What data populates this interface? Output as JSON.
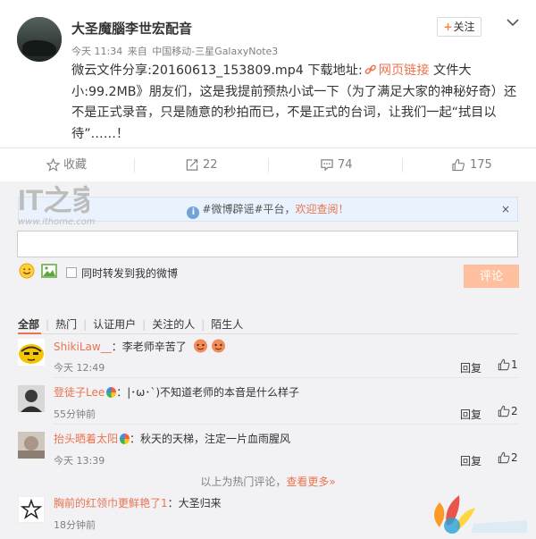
{
  "post": {
    "username": "大圣魔腦李世宏配音",
    "follow_label": "关注",
    "follow_plus": "+",
    "meta_time": "今天 11:34",
    "meta_from": "来自",
    "meta_source": "中国移动-三星GalaxyNote3",
    "content_before_link": "微云文件分享:20160613_153809.mp4 下载地址:",
    "link_label": "网页链接",
    "content_after_link": " 文件大小:99.2MB》朋友们，这是我提前预热小试一下（为了满足大家的神秘好奇）还不是正式录音，只是随意的秒拍而已，不是正式的台词，让我们一起“拭目以待”……！"
  },
  "actions": {
    "favorite_label": "收藏",
    "repost_count": "22",
    "comment_count": "74",
    "like_count": "175"
  },
  "notice": {
    "info_glyph": "i",
    "tag_text": "#微博辟谣#平台，",
    "highlight": "欢迎查阅！",
    "close": "×"
  },
  "composer": {
    "input_value": "",
    "also_repost_label": "同时转发到我的微博",
    "submit_label": "评论"
  },
  "filters": {
    "active": "全部",
    "divider": "|",
    "items": [
      "热门",
      "认证用户",
      "关注的人",
      "陌生人"
    ]
  },
  "comments": [
    {
      "user": "ShikiLaw__",
      "text": "：李老师辛苦了",
      "time": "今天 12:49",
      "reply": "回复",
      "likes": "1"
    },
    {
      "user": "登徒子Lee",
      "text": "：|･ω･`)不知道老师的本音是什么样子",
      "time": "55分钟前",
      "reply": "回复",
      "likes": "2"
    },
    {
      "user": "抬头晒着太阳",
      "text": "：秋天的天梯，注定一片血雨腥风",
      "time": "今天 13:39",
      "reply": "回复",
      "likes": "2"
    },
    {
      "user": "胸前的红领巾更鲜艳了1",
      "text": "：大圣归来",
      "time": "18分钟前"
    }
  ],
  "more": {
    "prefix": "以上为热门评论，",
    "link": "查看更多»"
  },
  "watermark": {
    "left_logo_text": "IT之家",
    "left_url": "www.ithome.com"
  },
  "colors": {
    "accent": "#eb7350",
    "panel_bg": "#f2f2f5",
    "notice_bg": "#eaf3fd",
    "submit_disabled": "#ffc09f"
  },
  "icons": [
    "chevron-down-icon",
    "link-icon",
    "star-icon",
    "repost-icon",
    "comment-icon",
    "like-icon",
    "info-icon",
    "close-icon",
    "emoji-icon",
    "picture-icon",
    "checkbox-icon"
  ]
}
